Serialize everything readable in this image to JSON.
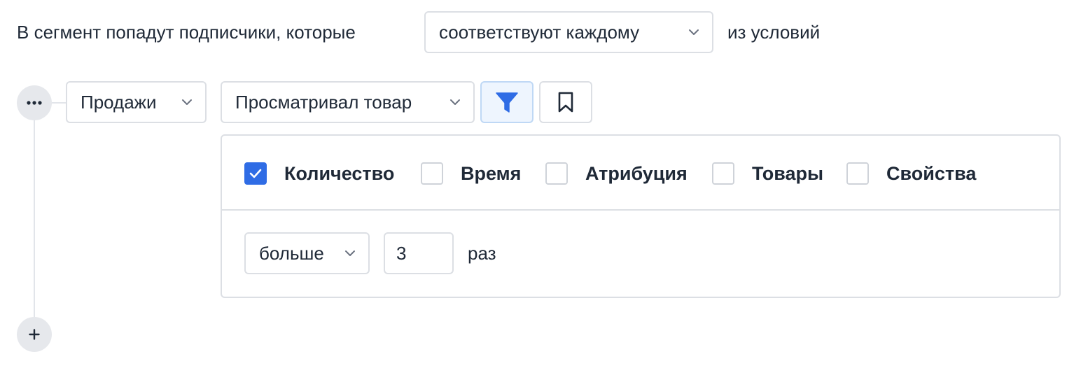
{
  "condition_header": {
    "prefix": "В сегмент попадут подписчики, которые",
    "match_mode": "соответствуют каждому",
    "suffix": "из условий"
  },
  "rule": {
    "menu_icon": "ellipsis-icon",
    "category": "Продажи",
    "event": "Просматривал товар",
    "filter_icon": "filter-icon",
    "bookmark_icon": "bookmark-icon",
    "filter_active": true
  },
  "filters": {
    "options": [
      {
        "label": "Количество",
        "checked": true
      },
      {
        "label": "Время",
        "checked": false
      },
      {
        "label": "Атрибуция",
        "checked": false
      },
      {
        "label": "Товары",
        "checked": false
      },
      {
        "label": "Свойства",
        "checked": false
      }
    ],
    "quantity": {
      "operator": "больше",
      "value": "3",
      "unit": "раз"
    }
  },
  "add_condition_icon": "plus-icon",
  "colors": {
    "accent": "#2f6ce5",
    "border": "#dcdfe4",
    "active_bg": "#eef5fe"
  }
}
